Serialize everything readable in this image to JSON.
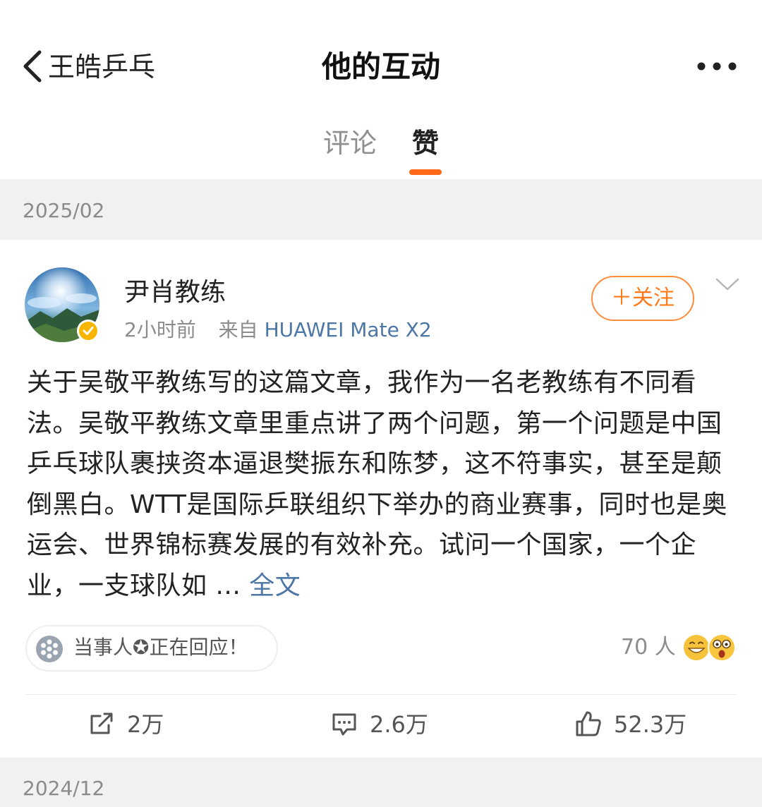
{
  "nav": {
    "back_label": "王皓乒乓",
    "title": "他的互动"
  },
  "tabs": [
    {
      "label": "评论",
      "active": false
    },
    {
      "label": "赞",
      "active": true
    }
  ],
  "sections": [
    {
      "date": "2025/02"
    },
    {
      "date": "2024/12"
    }
  ],
  "post": {
    "author": "尹肖教练",
    "time": "2小时前",
    "source_prefix": "来自",
    "source": "HUAWEI Mate X2",
    "follow_label": "＋关注",
    "text": "关于吴敬平教练写的这篇文章，我作为一名老教练有不同看法。吴敬平教练文章里重点讲了两个问题，第一个问题是中国乒乓球队裹挟资本逼退樊振东和陈梦，这不符事实，甚至是颠倒黑白。WTT是国际乒联组织下举办的商业赛事，同时也是奥运会、世界锦标赛发展的有效补充。试问一个国家，一个企业，一支球队如 ... ",
    "more_label": "全文",
    "topic_pill": "当事人✪正在回应！",
    "reaction_count": "70 人",
    "actions": {
      "repost": "2万",
      "comment": "2.6万",
      "like": "52.3万"
    }
  },
  "colors": {
    "accent": "#ff6a1a",
    "link": "#4b76a6",
    "band": "#f1f1f1"
  },
  "icons": [
    "back-arrow-icon",
    "more-dots-icon",
    "verified-badge-icon",
    "chevron-down-icon",
    "topic-icon",
    "grin-emoji-icon",
    "shocked-emoji-icon",
    "repost-icon",
    "comment-icon",
    "like-icon"
  ]
}
